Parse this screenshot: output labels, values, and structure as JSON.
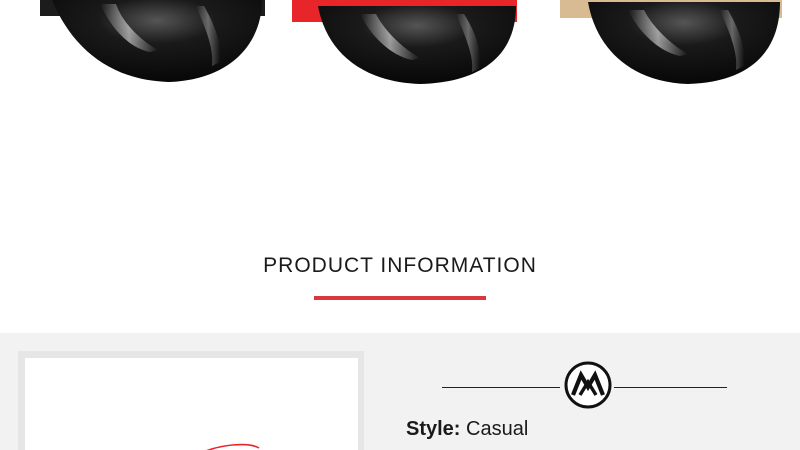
{
  "hero": {
    "products": [
      {
        "crown_color": "#1c1c1c",
        "visor_color": "#0d0d0d"
      },
      {
        "crown_color": "#e8262a",
        "visor_color": "#0d0d0d"
      },
      {
        "crown_color": "#d9bb93",
        "visor_color": "#0d0d0d"
      }
    ]
  },
  "section": {
    "title": "PRODUCT INFORMATION",
    "accent_color": "#d9393c"
  },
  "details": {
    "logo_icon": "brand-monogram-icon",
    "specs": [
      {
        "key": "Style:",
        "value": " Casual"
      }
    ]
  }
}
